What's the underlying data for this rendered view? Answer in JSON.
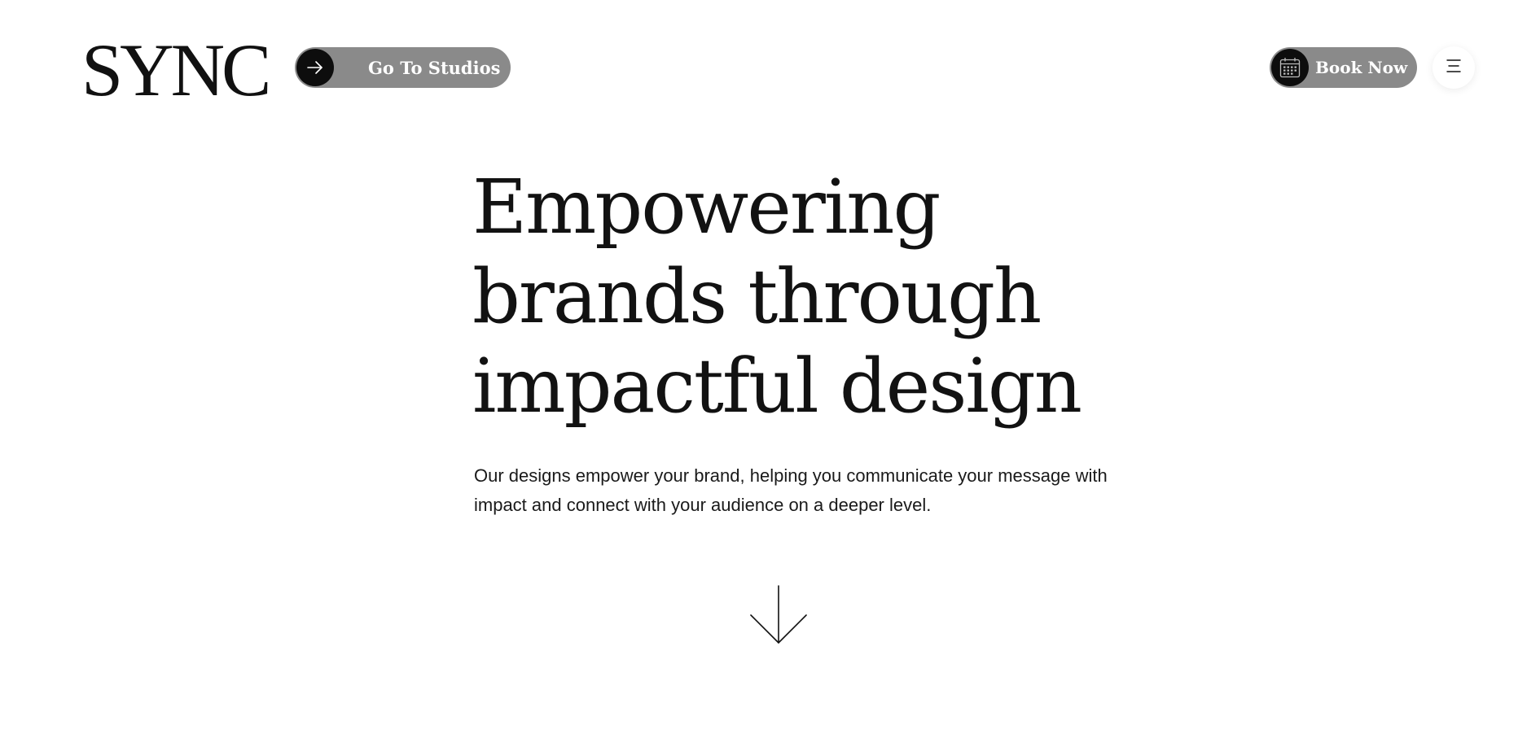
{
  "header": {
    "logo_text": "SYNC",
    "studios_button_label": "Go To Studios",
    "book_button_label": "Book Now",
    "icons": {
      "studios": "arrow-right-icon",
      "book": "calendar-icon",
      "menu": "menu-icon"
    },
    "colors": {
      "pill_background": "#8a8a8a",
      "icon_circle": "#0d0d0d"
    }
  },
  "hero": {
    "headline_lines": [
      "Empowering",
      "brands through",
      "impactful design"
    ],
    "subtext": "Our designs empower your brand, helping you communicate your message with impact and connect with your audience on a deeper level.",
    "scroll_icon": "arrow-down-icon"
  }
}
